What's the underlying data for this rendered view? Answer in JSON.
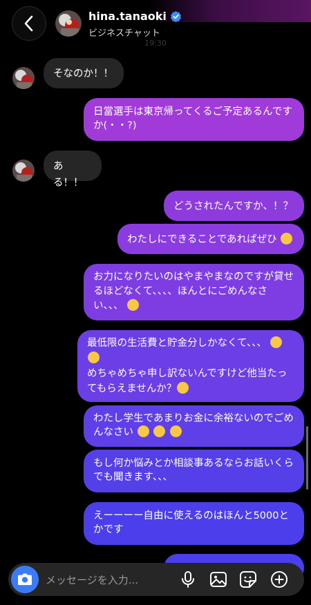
{
  "header": {
    "username": "hina.tanaoki",
    "subtitle": "ビジネスチャット",
    "timestamp": "19:30"
  },
  "messages": [
    {
      "side": "received",
      "text": "そなのか！！"
    },
    {
      "side": "sent",
      "text": "日當選手は東京帰ってくるご予定あるんですか(・・?)"
    },
    {
      "side": "received",
      "text": "ある！！"
    },
    {
      "side": "sent",
      "text": "どうされたんですか、！？"
    },
    {
      "side": "sent",
      "text": "わたしにできることであればぜひ",
      "emoji": [
        "pensive"
      ]
    },
    {
      "side": "sent",
      "text_lines": [
        "お力になりたいのはやまやまなのですが貸せ",
        "るほどなくて、、、、ほんとにごめんなさ",
        "い、、、"
      ],
      "emoji": [
        "crying"
      ]
    },
    {
      "side": "sent",
      "text_lines": [
        "最低限の生活費と貯金分しかなくて、、、",
        "めちゃめちゃ申し訳ないんですけど他当たっ",
        "てもらえませんか？"
      ],
      "emoji": [
        "holding-tears",
        "holding-tears",
        "crying"
      ]
    },
    {
      "side": "sent",
      "text_lines": [
        "わたし学生であまりお金に余裕ないのでごめ",
        "んなさい"
      ],
      "emoji": [
        "crying",
        "crying",
        "crying"
      ]
    },
    {
      "side": "sent",
      "text_lines": [
        "もし何か悩みとか相談事あるならお話いくら",
        "でも聞きます、、、"
      ]
    },
    {
      "side": "sent",
      "text_lines": [
        "えーーーー自由に使えるのはほんと5000と",
        "かです"
      ]
    }
  ],
  "composer": {
    "placeholder": "メッセージを入力..."
  },
  "colors": {
    "sent_top": "#a13ad6",
    "sent_bottom": "#4f3ded",
    "received": "#262626",
    "camera": "#3b7cf6"
  }
}
